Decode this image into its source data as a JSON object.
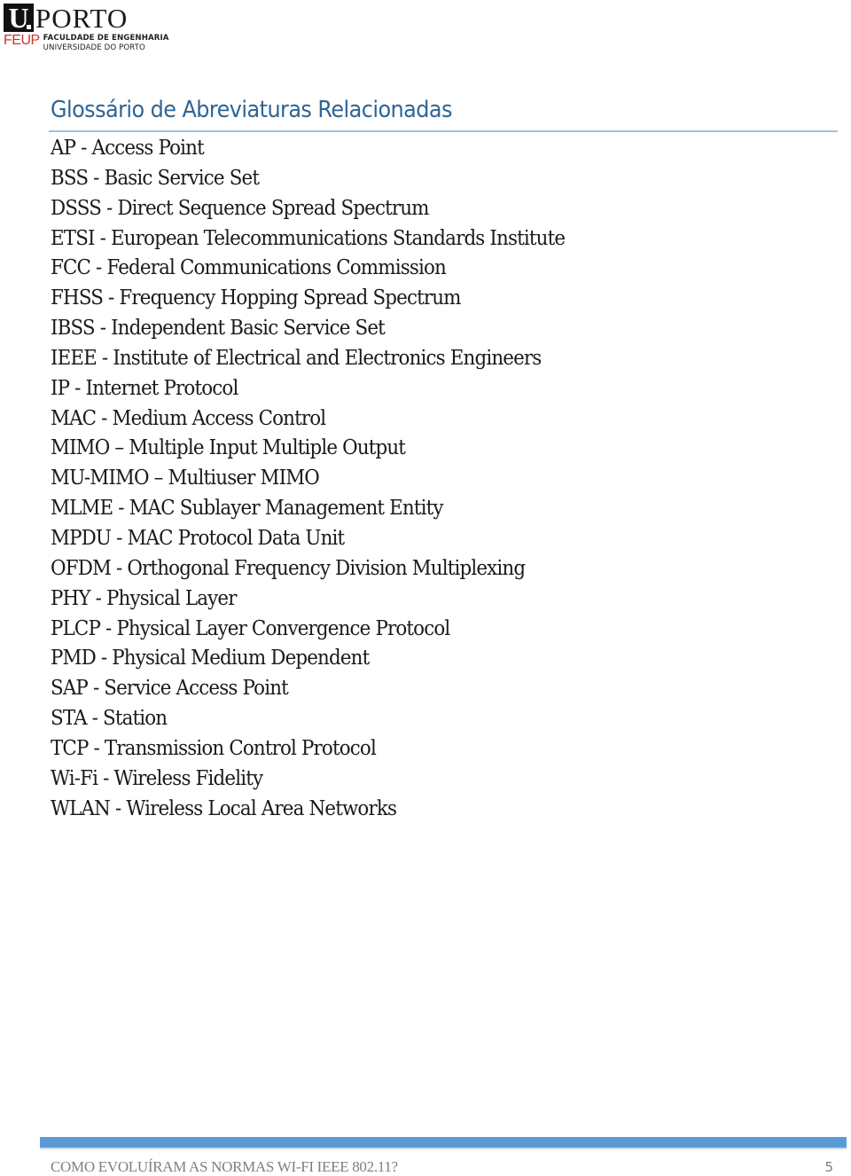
{
  "header": {
    "logo": {
      "letter": "U",
      "name": "PORTO",
      "school_abbr": "FEUP",
      "school_line1": "FACULDADE DE ENGENHARIA",
      "school_line2": "UNIVERSIDADE DO PORTO"
    }
  },
  "section": {
    "title": "Glossário de Abreviaturas Relacionadas"
  },
  "glossary": [
    "AP - Access Point",
    "BSS - Basic Service Set",
    "DSSS - Direct Sequence Spread Spectrum",
    "ETSI - European Telecommunications Standards Institute",
    "FCC - Federal Communications Commission",
    "FHSS - Frequency Hopping Spread Spectrum",
    "IBSS - Independent Basic Service Set",
    "IEEE - Institute of Electrical and Electronics Engineers",
    "IP - Internet Protocol",
    "MAC - Medium Access Control",
    "MIMO – Multiple Input Multiple Output",
    "MU-MIMO – Multiuser MIMO",
    "MLME - MAC Sublayer Management Entity",
    "MPDU - MAC Protocol Data Unit",
    "OFDM - Orthogonal Frequency Division Multiplexing",
    "PHY - Physical Layer",
    "PLCP - Physical Layer Convergence Protocol",
    "PMD - Physical Medium Dependent",
    "SAP - Service Access Point",
    "STA - Station",
    "TCP - Transmission Control Protocol",
    "Wi-Fi - Wireless Fidelity",
    "WLAN - Wireless Local Area Networks"
  ],
  "footer": {
    "title": "COMO EVOLUÍRAM AS NORMAS WI-FI IEEE 802.11?",
    "page_number": "5"
  },
  "colors": {
    "heading": "#2e6595",
    "heading_rule": "#a9bfd0",
    "footer_bar": "#5b9bd5",
    "footer_text": "#7f7f7f",
    "logo_red": "#c8352b"
  }
}
